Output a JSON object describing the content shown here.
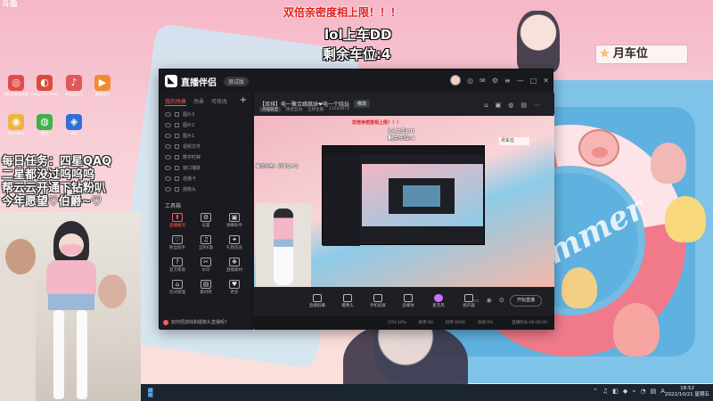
{
  "overlay": {
    "banner": "双倍亲密度相上限！！！",
    "queue_title": "lol上车DD",
    "queue_remaining": "剩余车位:4",
    "seat_label": "月车位",
    "daily_lines": [
      "每日任务：四星QAQ",
      "二星都没过呜呜呜",
      "帮云云开通下钻粉叭",
      "今年愿望♡伯爵~♡"
    ]
  },
  "desktop": {
    "logo_text": "斗鱼",
    "icons": [
      {
        "label": "360安全浏览器",
        "color": "#e34b4b",
        "glyph": "◎"
      },
      {
        "label": "Google Chrome",
        "color": "#d94c3d",
        "glyph": "◐"
      },
      {
        "label": "网易云音乐",
        "color": "#e0585a",
        "glyph": "♪"
      },
      {
        "label": "直播伴侣",
        "color": "#f08b32",
        "glyph": "▶"
      },
      {
        "label": "WeGame",
        "color": "#f0b43c",
        "glyph": "◉"
      },
      {
        "label": "微信",
        "color": "#3bb34a",
        "glyph": "◍"
      },
      {
        "label": "QQ",
        "color": "#2e6fd8",
        "glyph": "◈"
      }
    ]
  },
  "app": {
    "name": "直播伴侣",
    "version": "测试版",
    "tabs": [
      "我的场景",
      "场景",
      "可修改"
    ],
    "sources": [
      "图片3",
      "图片2",
      "图片1",
      "视频文件",
      "数字时钟",
      "窗口捕获",
      "自摄卡",
      "摄像头"
    ],
    "tools_title": "工具箱",
    "tools": [
      {
        "label": "直播推流",
        "glyph": "⬆",
        "active": true
      },
      {
        "label": "设置",
        "glyph": "⚙",
        "active": false
      },
      {
        "label": "弹幕助手",
        "glyph": "▣",
        "active": false
      },
      {
        "label": "粉丝助手",
        "glyph": "♡",
        "active": false
      },
      {
        "label": "全民K歌",
        "glyph": "♫",
        "active": false
      },
      {
        "label": "礼物连击",
        "glyph": "✦",
        "active": false
      },
      {
        "label": "官方帮助",
        "glyph": "?",
        "active": false
      },
      {
        "label": "水印",
        "glyph": "✂",
        "active": false
      },
      {
        "label": "直播素材",
        "glyph": "❖",
        "active": false
      },
      {
        "label": "房间管理",
        "glyph": "⌂",
        "active": false
      },
      {
        "label": "素材库",
        "glyph": "▤",
        "active": false
      },
      {
        "label": "更多",
        "glyph": "♥",
        "active": false
      }
    ],
    "footer_text": "如何把游戏和摄像头直播呢?",
    "stream_title": "【双排】电一聚合跳跳球❤电一个陪玩",
    "modify_label": "修改",
    "sub_tag": "英雄联盟",
    "sub_items": [
      "情感互动",
      "王牌主播",
      "11543973"
    ],
    "controls": [
      {
        "label": "直播屏幕",
        "mic": false
      },
      {
        "label": "摄像头",
        "mic": false
      },
      {
        "label": "手机投屏",
        "mic": false
      },
      {
        "label": "多媒体",
        "mic": false
      },
      {
        "label": "麦克风",
        "mic": true
      },
      {
        "label": "扬声器",
        "mic": false
      }
    ],
    "start_label": "开始直播",
    "status_items": [
      "CPU:34%",
      "帧率:60",
      "码率:6000",
      "丢帧:0%"
    ],
    "status_right": "直播时长:00:00:00"
  },
  "preview": {
    "banner": "双倍亲密度相上限！！！",
    "line1": "lol上车DD",
    "line2": "剩余车位:4",
    "seat": "月车位",
    "daily": "每日任务：四星QAQ"
  },
  "taskbar": {
    "time": "18:52",
    "date": "2022/10/21 星期五",
    "tray": [
      "⌃",
      "♫",
      "◧",
      "◆",
      "⌁",
      "◔",
      "▤",
      "A"
    ]
  }
}
